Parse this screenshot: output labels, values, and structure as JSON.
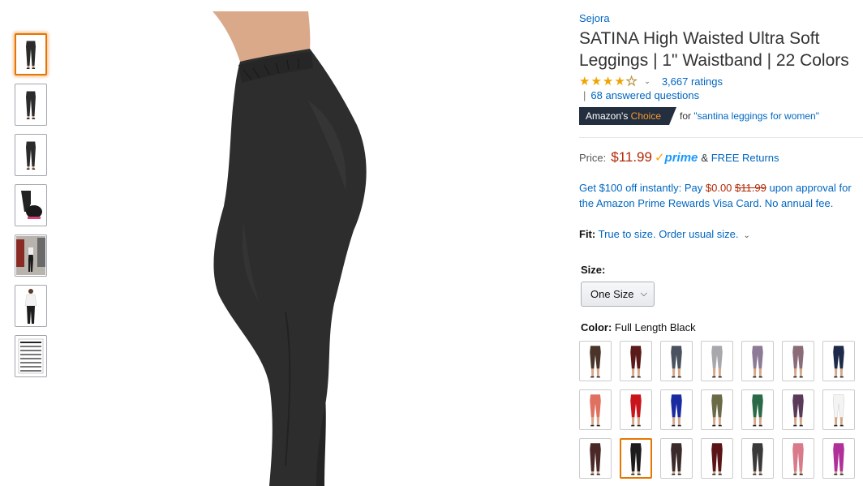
{
  "product": {
    "brand": "Sejora",
    "title": "SATINA High Waisted Ultra Soft Leggings | 1\" Waistband | 22 Colors",
    "rating_value": 4.3,
    "ratings_text": "3,667 ratings",
    "separator": "|",
    "answered_text": "68 answered questions",
    "choice": {
      "badge_prefix": "Amazon's",
      "badge_accent": "Choice",
      "for_prefix": "for",
      "for_link": "\"santina leggings for women\""
    },
    "price": {
      "label": "Price:",
      "value": "$11.99",
      "prime_check": "✓",
      "prime_word": "prime",
      "amp": "&",
      "free_returns": "FREE Returns"
    },
    "offer": {
      "pre": "Get $100 off instantly: Pay",
      "pay": "$0.00",
      "original": "$11.99",
      "post": "upon approval for the Amazon Prime Rewards Visa Card. No annual fee."
    },
    "fit": {
      "label": "Fit:",
      "value": "True to size. Order usual size."
    },
    "size": {
      "label": "Size:",
      "selected": "One Size"
    },
    "color": {
      "label": "Color:",
      "selected": "Full Length Black"
    }
  },
  "colors": {
    "accent": "#e77600",
    "link": "#0066c0",
    "price": "#b12704",
    "legging": "#2b2b2b"
  },
  "thumbnails": [
    {
      "kind": "legs",
      "selected": true
    },
    {
      "kind": "legs-side",
      "selected": false
    },
    {
      "kind": "legs-back",
      "selected": false
    },
    {
      "kind": "packaging",
      "selected": false
    },
    {
      "kind": "street-photo",
      "selected": false
    },
    {
      "kind": "model-white-top",
      "selected": false
    },
    {
      "kind": "size-chart",
      "selected": false
    }
  ],
  "swatches": [
    {
      "color": "#4a3328",
      "length": "capri",
      "selected": false
    },
    {
      "color": "#5a1a1a",
      "length": "capri",
      "selected": false
    },
    {
      "color": "#4a5260",
      "length": "capri",
      "selected": false
    },
    {
      "color": "#a8a8ac",
      "length": "capri",
      "selected": false
    },
    {
      "color": "#8c7a96",
      "length": "capri",
      "selected": false
    },
    {
      "color": "#8a6c78",
      "length": "capri",
      "selected": false
    },
    {
      "color": "#1e2a4a",
      "length": "capri",
      "selected": false
    },
    {
      "color": "#e07060",
      "length": "capri",
      "selected": false
    },
    {
      "color": "#c8141a",
      "length": "capri",
      "selected": false
    },
    {
      "color": "#1a2aa0",
      "length": "capri",
      "selected": false
    },
    {
      "color": "#6a6a48",
      "length": "capri",
      "selected": false
    },
    {
      "color": "#2a6a48",
      "length": "capri",
      "selected": false
    },
    {
      "color": "#5a3a58",
      "length": "capri",
      "selected": false
    },
    {
      "color": "#f4f4f2",
      "length": "capri",
      "selected": false
    },
    {
      "color": "#4a2828",
      "length": "full",
      "selected": false
    },
    {
      "color": "#1c1c1c",
      "length": "full",
      "selected": true
    },
    {
      "color": "#3a2a2a",
      "length": "full",
      "selected": false
    },
    {
      "color": "#5a1418",
      "length": "full",
      "selected": false
    },
    {
      "color": "#3a3a3a",
      "length": "full",
      "selected": false
    },
    {
      "color": "#d87a8a",
      "length": "full",
      "selected": false
    },
    {
      "color": "#b0309a",
      "length": "full",
      "selected": false
    }
  ]
}
